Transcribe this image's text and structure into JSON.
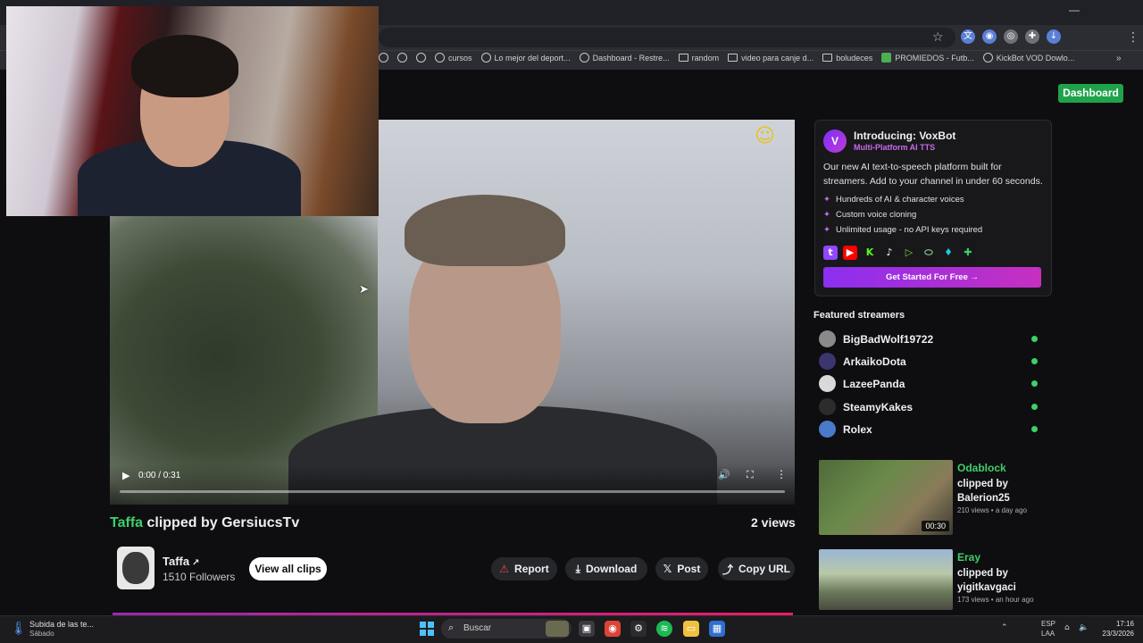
{
  "browser": {
    "bookmarks": [
      "cursos",
      "Lo mejor del deport...",
      "Dashboard - Restre...",
      "random",
      "video para canje d...",
      "boludeces",
      "PROMIEDOS - Futb...",
      "KickBot VOD Dowlo..."
    ],
    "bookmarks_more": "»"
  },
  "header": {
    "dashboard_label": "Dashboard"
  },
  "video": {
    "time": "0:00 / 0:31",
    "progress": 0.0
  },
  "clip": {
    "streamer": "Taffa",
    "clipped_by_text": " clipped by GersiucsTv",
    "views": "2 views"
  },
  "streamer_card": {
    "name": "Taffa",
    "followers": "1510 Followers",
    "view_all_label": "View all clips"
  },
  "actions": {
    "report": "Report",
    "download": "Download",
    "post": "Post",
    "copy_url": "Copy URL"
  },
  "voxbot": {
    "logo_letter": "V",
    "title": "Introducing: VoxBot",
    "subtitle": "Multi-Platform AI TTS",
    "description": "Our new AI text-to-speech platform built for streamers. Add to your channel in under 60 seconds.",
    "features": [
      "Hundreds of AI & character voices",
      "Custom voice cloning",
      "Unlimited usage - no API keys required"
    ],
    "cta": "Get Started For Free →"
  },
  "featured": {
    "heading": "Featured streamers",
    "streamers": [
      {
        "name": "BigBadWolf19722",
        "online": true
      },
      {
        "name": "ArkaikoDota",
        "online": true
      },
      {
        "name": "LazeePanda",
        "online": true
      },
      {
        "name": "SteamyKakes",
        "online": true
      },
      {
        "name": "Rolex",
        "online": true
      }
    ]
  },
  "side_clips": [
    {
      "name": "Odablock",
      "by_line1": "clipped by",
      "by_line2": "Balerion25",
      "meta": "210 views • a day ago",
      "duration": "00:30"
    },
    {
      "name": "Eray",
      "by_line1": "clipped by",
      "by_line2": "yigitkavgaci",
      "meta": "173 views • an hour ago",
      "duration": ""
    }
  ],
  "taskbar": {
    "weather_line1": "Subida de las te...",
    "weather_line2": "Sábado",
    "search_placeholder": "Buscar",
    "lang1": "ESP",
    "lang2": "LAA",
    "time": "17:16",
    "date": "23/3/2026"
  }
}
